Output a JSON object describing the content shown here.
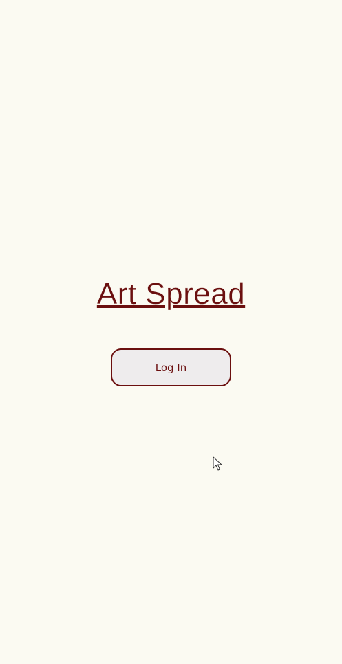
{
  "app": {
    "title": "Art Spread"
  },
  "actions": {
    "login_label": "Log In"
  },
  "icons": {
    "pointer": "mouse-pointer-icon"
  },
  "colors": {
    "background": "#fbfaf2",
    "accent": "#6b0f0f",
    "button_fill": "#eeeced"
  }
}
